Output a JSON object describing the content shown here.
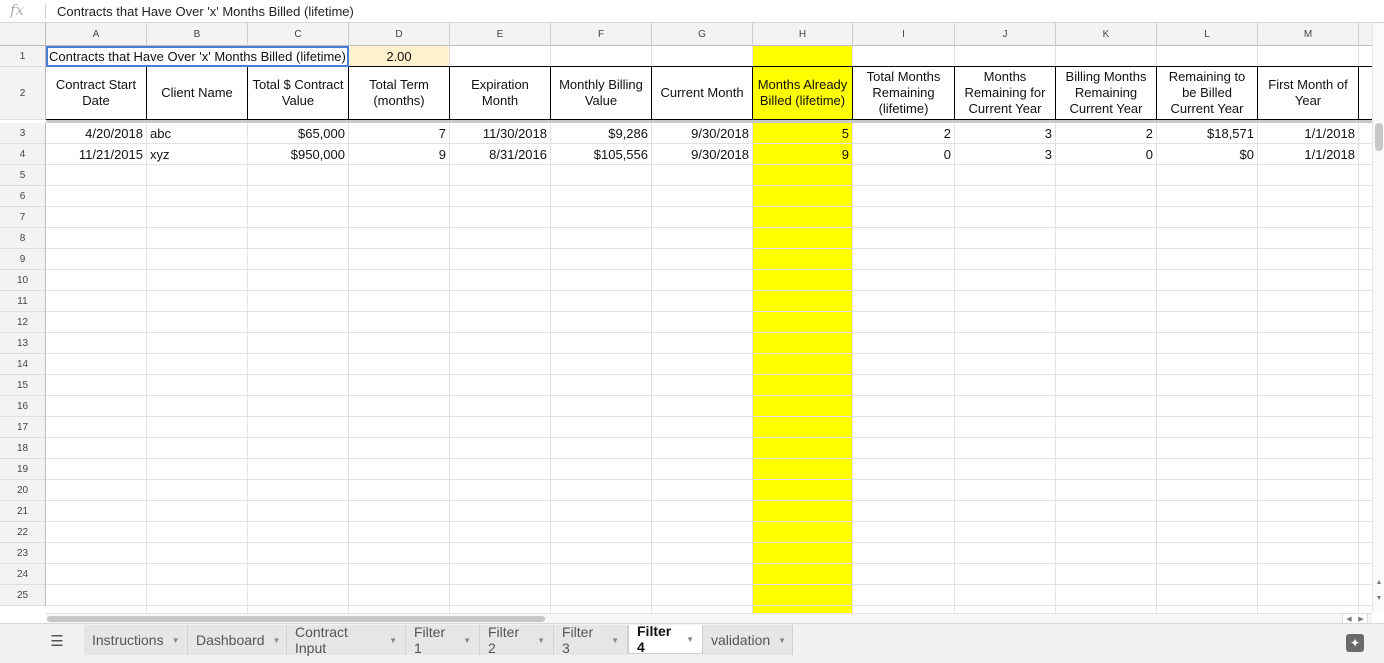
{
  "formula_bar": {
    "fx_label": "fx",
    "content": "Contracts that Have Over 'x' Months Billed (lifetime)"
  },
  "columns": [
    "A",
    "B",
    "C",
    "D",
    "E",
    "F",
    "G",
    "H",
    "I",
    "J",
    "K",
    "L",
    "M"
  ],
  "rows": [
    "1",
    "2",
    "3",
    "4",
    "5",
    "6",
    "7",
    "8",
    "9",
    "10",
    "11",
    "12",
    "13",
    "14",
    "15",
    "16",
    "17",
    "18",
    "19",
    "20",
    "21",
    "22",
    "23",
    "24",
    "25"
  ],
  "sheet": {
    "row1": {
      "title": "Contracts that Have Over 'x' Months Billed (lifetime)",
      "threshold": "2.00"
    },
    "headers": [
      "Contract Start Date",
      "Client Name",
      "Total $ Contract Value",
      "Total Term (months)",
      "Expiration Month",
      "Monthly Billing Value",
      "Current Month",
      "Months Already Billed (lifetime)",
      "Total Months Remaining (lifetime)",
      "Months Remaining for Current Year",
      "Billing Months Remaining Current Year",
      "Remaining to be Billed Current Year",
      "First Month of Year"
    ],
    "data_rows": [
      [
        "4/20/2018",
        "abc",
        "$65,000",
        "7",
        "11/30/2018",
        "$9,286",
        "9/30/2018",
        "5",
        "2",
        "3",
        "2",
        "$18,571",
        "1/1/2018"
      ],
      [
        "11/21/2015",
        "xyz",
        "$950,000",
        "9",
        "8/31/2016",
        "$105,556",
        "9/30/2018",
        "9",
        "0",
        "3",
        "0",
        "$0",
        "1/1/2018"
      ]
    ]
  },
  "colors": {
    "highlight_column": "#ffff00",
    "threshold_cell": "#fff2cc",
    "selection_border": "#4a7bd6"
  },
  "tabs": [
    {
      "label": "Instructions",
      "active": false
    },
    {
      "label": "Dashboard",
      "active": false
    },
    {
      "label": "Contract Input",
      "active": false
    },
    {
      "label": "Filter 1",
      "active": false
    },
    {
      "label": "Filter 2",
      "active": false
    },
    {
      "label": "Filter 3",
      "active": false
    },
    {
      "label": "Filter 4",
      "active": true
    },
    {
      "label": "validation",
      "active": false
    }
  ],
  "icons": {
    "all_sheets": "hamburger-menu-icon",
    "explore": "explore-icon"
  }
}
